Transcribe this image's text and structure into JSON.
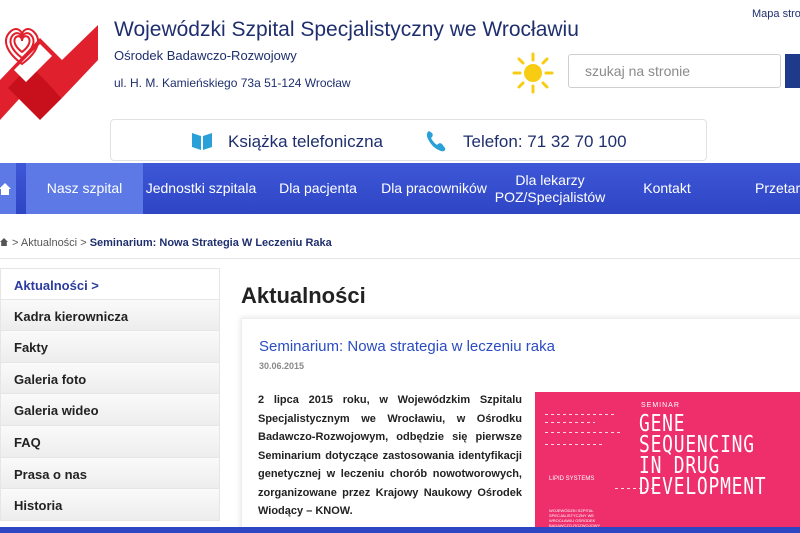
{
  "header": {
    "title": "Wojewódzki Szpital Specjalistyczny we Wrocławiu",
    "subtitle": "Ośrodek Badawczo-Rozwojowy",
    "address": "ul. H. M. Kamieńskiego 73a 51-124 Wrocław",
    "sitemap_link": "Mapa strony",
    "search_placeholder": "szukaj na stronie"
  },
  "contact": {
    "phonebook_label": "Książka telefoniczna",
    "phone_label": "Telefon: 71 32 70 100"
  },
  "nav": {
    "items": [
      {
        "label": "Nasz szpital",
        "active": true
      },
      {
        "label": "Jednostki szpitala"
      },
      {
        "label": "Dla pacjenta"
      },
      {
        "label": "Dla pracowników"
      },
      {
        "label": "Dla lekarzy\nPOZ/Specjalistów"
      },
      {
        "label": "Kontakt"
      },
      {
        "label": "Przetargi"
      }
    ]
  },
  "breadcrumb": {
    "parent": "Aktualności",
    "current": "Seminarium: Nowa Strategia W Leczeniu Raka"
  },
  "sidebar": {
    "items": [
      {
        "label": "Aktualności >",
        "active": true
      },
      {
        "label": "Kadra kierownicza"
      },
      {
        "label": "Fakty"
      },
      {
        "label": "Galeria foto"
      },
      {
        "label": "Galeria wideo"
      },
      {
        "label": "FAQ"
      },
      {
        "label": "Prasa o nas"
      },
      {
        "label": "Historia"
      }
    ]
  },
  "main": {
    "heading": "Aktualności",
    "article": {
      "title": "Seminarium: Nowa strategia w leczeniu raka",
      "date": "30.06.2015",
      "body": "2 lipca 2015 roku, w Wojewódzkim Szpitalu Specjalistycznym we Wrocławiu, w Ośrodku Badawczo-Rozwojowym, odbędzie się pierwsze Seminarium dotyczące zastosowania identyfikacji genetycznej w leczeniu chorób nowotworowych, zorganizowane przez Krajowy Naukowy Ośrodek Wiodący – KNOW.",
      "image": {
        "tag": "SEMINAR",
        "headline": "GENE SEQUENCING IN DRUG DEVELOPMENT",
        "brand": "LIPID SYSTEMS",
        "sponsor": "WOJEWÓDZKI SZPITAL SPECJALISTYCZNY WE WROCŁAWIU OŚRODEK BADAWCZO-ROZWOJOWY",
        "background_color": "#ee2f6c"
      }
    }
  },
  "colors": {
    "brand_navy": "#1f2f6e",
    "nav_blue": "#2e46c4",
    "nav_active": "#5c79e6",
    "logo_red": "#e0202c",
    "link_blue": "#2b4cc2"
  }
}
